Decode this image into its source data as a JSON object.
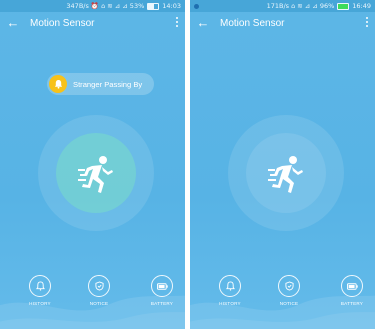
{
  "left": {
    "status": {
      "text": "347B/s ⏰ ⌂ ≋ ⊿ ⊿ 53%",
      "time": "14:03",
      "battery_level": 0.53
    },
    "title": "Motion Sensor",
    "notice": "Stranger Passing By",
    "nav": {
      "history": "HISTORY",
      "notice": "NOTICE",
      "battery": "BATTERY"
    }
  },
  "right": {
    "status": {
      "text": "171B/s ⌂ ≋ ⊿ ⊿ 96%",
      "time": "16:49",
      "battery_level": 0.96
    },
    "title": "Motion Sensor",
    "nav": {
      "history": "HISTORY",
      "notice": "NOTICE",
      "battery": "BATTERY"
    }
  },
  "icons": {
    "back": "arrow-left-icon",
    "more": "more-vertical-icon",
    "bell": "bell-icon",
    "runner": "running-person-icon",
    "history": "bell-outline-icon",
    "notice": "shield-check-icon",
    "battery": "battery-icon"
  },
  "colors": {
    "background": "#5db6e6",
    "accent_bell": "#f7c21a",
    "inner_active": "#78dcc8"
  }
}
